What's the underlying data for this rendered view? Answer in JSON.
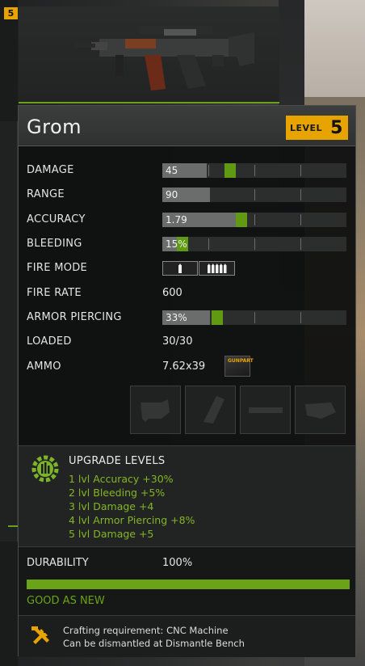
{
  "top_badge": "5",
  "weapon": {
    "name": "Grom",
    "level_label": "LEVEL",
    "level": "5"
  },
  "stats": [
    {
      "label": "DAMAGE",
      "type": "bar",
      "value": "45",
      "fill": 0.24,
      "accent": 0.4
    },
    {
      "label": "RANGE",
      "type": "bar",
      "value": "90",
      "fill": 0.26,
      "accent": null
    },
    {
      "label": "ACCURACY",
      "type": "bar",
      "value": "1.79",
      "fill": 0.42,
      "accent": 0.46
    },
    {
      "label": "BLEEDING",
      "type": "bar",
      "value": "15%",
      "fill": 0.14,
      "accent": 0.1
    },
    {
      "label": "FIRE MODE",
      "type": "firemode"
    },
    {
      "label": "FIRE RATE",
      "type": "text",
      "value": "600"
    },
    {
      "label": "ARMOR PIERCING",
      "type": "bar",
      "value": "33%",
      "fill": 0.26,
      "accent": 0.33
    },
    {
      "label": "LOADED",
      "type": "text",
      "value": "30/30"
    },
    {
      "label": "AMMO",
      "type": "ammo",
      "value": "7.62x39"
    }
  ],
  "ammo_box_label": "GUNPART",
  "attachment_slots": [
    "scope-slot-icon",
    "magazine-slot-icon",
    "barrel-slot-icon",
    "grip-slot-icon"
  ],
  "upgrades": {
    "title": "UPGRADE LEVELS",
    "items": [
      "1 lvl Accuracy +30%",
      "2 lvl Bleeding +5%",
      "3 lvl Damage +4",
      "4 lvl Armor Piercing +8%",
      "5 lvl Damage +5"
    ]
  },
  "durability": {
    "label": "DURABILITY",
    "value": "100%",
    "fill": 1.0,
    "status": "GOOD AS NEW"
  },
  "crafting": {
    "requirement": "Crafting requirement: CNC Machine",
    "dismantle": "Can be dismantled at Dismantle Bench"
  },
  "colors": {
    "accent_green": "#6aa416",
    "upgrade_text": "#83b524",
    "level_badge": "#e7a300"
  }
}
